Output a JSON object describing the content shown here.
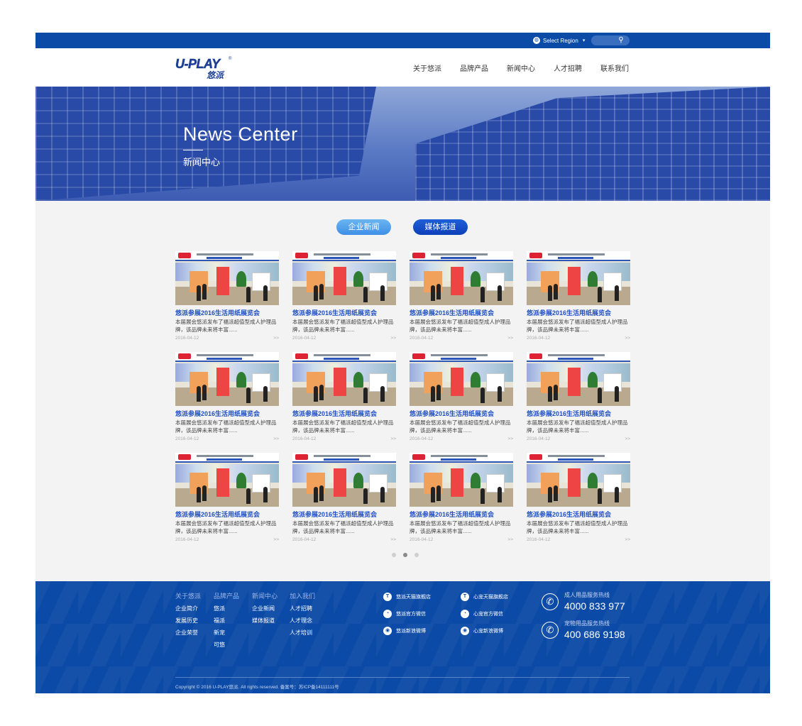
{
  "topbar": {
    "region_label": "Select Region",
    "region_arrow": "▾",
    "search_icon": "⚲"
  },
  "header": {
    "logo_text": "U-PLAY",
    "logo_cn": "悠派",
    "logo_reg": "®",
    "nav": [
      "关于悠派",
      "品牌产品",
      "新闻中心",
      "人才招聘",
      "联系我们"
    ]
  },
  "banner": {
    "title": "News Center",
    "subtitle": "新闻中心"
  },
  "tabs": [
    "企业新闻",
    "媒体报道"
  ],
  "news": [
    {
      "title": "悠派参展2016生活用纸展览会",
      "desc": "本届展会悠派发布了福派超值型成人护理品牌，该品牌未来将丰富......",
      "date": "2016-04-12",
      "more": ">>"
    },
    {
      "title": "悠派参展2016生活用纸展览会",
      "desc": "本届展会悠派发布了福派超值型成人护理品牌，该品牌未来将丰富......",
      "date": "2016-04-12",
      "more": ">>"
    },
    {
      "title": "悠派参展2016生活用纸展览会",
      "desc": "本届展会悠派发布了福派超值型成人护理品牌，该品牌未来将丰富......",
      "date": "2016-04-12",
      "more": ">>"
    },
    {
      "title": "悠派参展2016生活用纸展览会",
      "desc": "本届展会悠派发布了福派超值型成人护理品牌，该品牌未来将丰富......",
      "date": "2016-04-12",
      "more": ">>"
    },
    {
      "title": "悠派参展2016生活用纸展览会",
      "desc": "本届展会悠派发布了福派超值型成人护理品牌，该品牌未来将丰富......",
      "date": "2016-04-12",
      "more": ">>"
    },
    {
      "title": "悠派参展2016生活用纸展览会",
      "desc": "本届展会悠派发布了福派超值型成人护理品牌，该品牌未来将丰富......",
      "date": "2016-04-12",
      "more": ">>"
    },
    {
      "title": "悠派参展2016生活用纸展览会",
      "desc": "本届展会悠派发布了福派超值型成人护理品牌，该品牌未来将丰富......",
      "date": "2016-04-12",
      "more": ">>"
    },
    {
      "title": "悠派参展2016生活用纸展览会",
      "desc": "本届展会悠派发布了福派超值型成人护理品牌，该品牌未来将丰富......",
      "date": "2016-04-12",
      "more": ">>"
    },
    {
      "title": "悠派参展2016生活用纸展览会",
      "desc": "本届展会悠派发布了福派超值型成人护理品牌，该品牌未来将丰富......",
      "date": "2016-04-12",
      "more": ">>"
    },
    {
      "title": "悠派参展2016生活用纸展览会",
      "desc": "本届展会悠派发布了福派超值型成人护理品牌，该品牌未来将丰富......",
      "date": "2016-04-12",
      "more": ">>"
    },
    {
      "title": "悠派参展2016生活用纸展览会",
      "desc": "本届展会悠派发布了福派超值型成人护理品牌，该品牌未来将丰富......",
      "date": "2016-04-12",
      "more": ">>"
    },
    {
      "title": "悠派参展2016生活用纸展览会",
      "desc": "本届展会悠派发布了福派超值型成人护理品牌，该品牌未来将丰富......",
      "date": "2016-04-12",
      "more": ">>"
    }
  ],
  "pagination": {
    "pages": 3,
    "active": 2
  },
  "footer": {
    "columns": [
      {
        "head": "关于悠派",
        "items": [
          "企业简介",
          "发展历史",
          "企业荣誉"
        ]
      },
      {
        "head": "品牌产品",
        "items": [
          "悠派",
          "福派",
          "新宠",
          "可悠"
        ]
      },
      {
        "head": "新闻中心",
        "items": [
          "企业新闻",
          "媒体报道"
        ]
      },
      {
        "head": "加入我们",
        "items": [
          "人才招聘",
          "人才理念",
          "人才培训"
        ]
      }
    ],
    "social_left": [
      "悠派天猫旗舰店",
      "悠派官方微信",
      "悠派新浪微博"
    ],
    "social_right": [
      "心宠天猫旗舰店",
      "心宠官方微信",
      "心宠新浪微博"
    ],
    "hotlines": [
      {
        "label": "成人用品服务热线",
        "number": "4000 833 977"
      },
      {
        "label": "宠物用品服务热线",
        "number": "400 686 9198"
      }
    ],
    "phone_icon": "✆",
    "copyright": "Copyright © 2016 U-PLAY悠派. All rights reserved. 备案号：苏ICP备14111111号"
  },
  "colors": {
    "brand": "#0b4aa6",
    "title_blue": "#1f4fc2",
    "content_bg": "#f3f3f3"
  }
}
